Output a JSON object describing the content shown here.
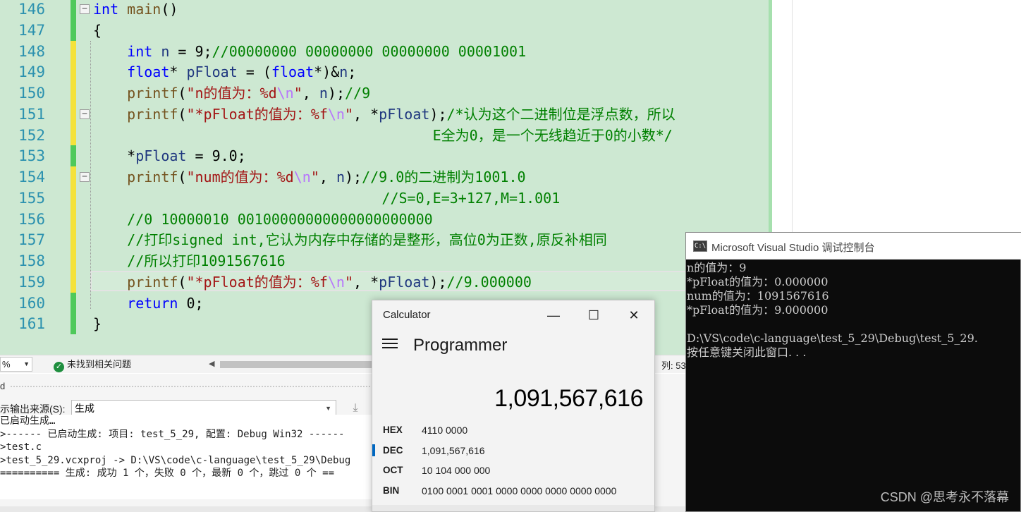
{
  "editor": {
    "lines": [
      {
        "num": "146",
        "bar": "#4fc95b",
        "fold": "−",
        "tokens": [
          [
            "kw",
            "int"
          ],
          [
            "plain",
            " "
          ],
          [
            "fn",
            "main"
          ],
          [
            "plain",
            "()"
          ]
        ]
      },
      {
        "num": "147",
        "bar": "#4fc95b",
        "fold": "",
        "tokens": [
          [
            "plain",
            "{"
          ]
        ]
      },
      {
        "num": "148",
        "bar": "#f4e23c",
        "fold": "",
        "tokens": [
          [
            "plain",
            "    "
          ],
          [
            "kw",
            "int"
          ],
          [
            "plain",
            " "
          ],
          [
            "var",
            "n"
          ],
          [
            "plain",
            " = 9;"
          ],
          [
            "cmt",
            "//00000000 00000000 00000000 00001001"
          ]
        ]
      },
      {
        "num": "149",
        "bar": "#f4e23c",
        "fold": "",
        "tokens": [
          [
            "plain",
            "    "
          ],
          [
            "kw",
            "float"
          ],
          [
            "plain",
            "* "
          ],
          [
            "var",
            "pFloat"
          ],
          [
            "plain",
            " = ("
          ],
          [
            "kw",
            "float"
          ],
          [
            "plain",
            "*)&"
          ],
          [
            "var",
            "n"
          ],
          [
            "plain",
            ";"
          ]
        ]
      },
      {
        "num": "150",
        "bar": "#f4e23c",
        "fold": "",
        "tokens": [
          [
            "plain",
            "    "
          ],
          [
            "fn",
            "printf"
          ],
          [
            "plain",
            "("
          ],
          [
            "str",
            "\"n的值为：%d"
          ],
          [
            "esc",
            "\\n"
          ],
          [
            "str",
            "\""
          ],
          [
            "plain",
            ", "
          ],
          [
            "var",
            "n"
          ],
          [
            "plain",
            ");"
          ],
          [
            "cmt",
            "//9"
          ]
        ]
      },
      {
        "num": "151",
        "bar": "#f4e23c",
        "fold": "−",
        "tokens": [
          [
            "plain",
            "    "
          ],
          [
            "fn",
            "printf"
          ],
          [
            "plain",
            "("
          ],
          [
            "str",
            "\"*pFloat的值为：%f"
          ],
          [
            "esc",
            "\\n"
          ],
          [
            "str",
            "\""
          ],
          [
            "plain",
            ", *"
          ],
          [
            "var",
            "pFloat"
          ],
          [
            "plain",
            ");"
          ],
          [
            "cmt",
            "/*认为这个二进制位是浮点数，所以"
          ]
        ]
      },
      {
        "num": "152",
        "bar": "#f4e23c",
        "fold": "",
        "tokens": [
          [
            "plain",
            "                                        "
          ],
          [
            "cmt",
            "E全为0，是一个无线趋近于0的小数*/"
          ]
        ]
      },
      {
        "num": "153",
        "bar": "#4fc95b",
        "fold": "",
        "tokens": [
          [
            "plain",
            "    *"
          ],
          [
            "var",
            "pFloat"
          ],
          [
            "plain",
            " = 9.0;"
          ]
        ]
      },
      {
        "num": "154",
        "bar": "#f4e23c",
        "fold": "−",
        "tokens": [
          [
            "plain",
            "    "
          ],
          [
            "fn",
            "printf"
          ],
          [
            "plain",
            "("
          ],
          [
            "str",
            "\"num的值为：%d"
          ],
          [
            "esc",
            "\\n"
          ],
          [
            "str",
            "\""
          ],
          [
            "plain",
            ", "
          ],
          [
            "var",
            "n"
          ],
          [
            "plain",
            ");"
          ],
          [
            "cmt",
            "//9.0的二进制为1001.0"
          ]
        ]
      },
      {
        "num": "155",
        "bar": "#f4e23c",
        "fold": "",
        "tokens": [
          [
            "plain",
            "                                  "
          ],
          [
            "cmt",
            "//S=0,E=3+127,M=1.001"
          ]
        ]
      },
      {
        "num": "156",
        "bar": "#f4e23c",
        "fold": "",
        "tokens": [
          [
            "plain",
            "    "
          ],
          [
            "cmt",
            "//0 10000010 00100000000000000000000"
          ]
        ]
      },
      {
        "num": "157",
        "bar": "#f4e23c",
        "fold": "",
        "tokens": [
          [
            "plain",
            "    "
          ],
          [
            "cmt",
            "//打印signed int,它认为内存中存储的是整形，高位0为正数,原反补相同"
          ]
        ]
      },
      {
        "num": "158",
        "bar": "#f4e23c",
        "fold": "",
        "tokens": [
          [
            "plain",
            "    "
          ],
          [
            "cmt",
            "//所以打印1091567616"
          ]
        ]
      },
      {
        "num": "159",
        "bar": "#f4e23c",
        "fold": "",
        "tokens": [
          [
            "plain",
            "    "
          ],
          [
            "fn",
            "printf"
          ],
          [
            "plain",
            "("
          ],
          [
            "str",
            "\"*pFloat的值为：%f"
          ],
          [
            "esc",
            "\\n"
          ],
          [
            "str",
            "\""
          ],
          [
            "plain",
            ", *"
          ],
          [
            "var",
            "pFloat"
          ],
          [
            "plain",
            ");"
          ],
          [
            "cmt",
            "//9.000000"
          ]
        ]
      },
      {
        "num": "160",
        "bar": "#4fc95b",
        "fold": "",
        "tokens": [
          [
            "plain",
            "    "
          ],
          [
            "kw",
            "return"
          ],
          [
            "plain",
            " 0;"
          ]
        ]
      },
      {
        "num": "161",
        "bar": "#4fc95b",
        "fold": "",
        "tokens": [
          [
            "plain",
            "}"
          ]
        ]
      }
    ]
  },
  "statusbar": {
    "zoom": "%",
    "issues": "未找到相关问题",
    "position": "列: 53"
  },
  "output": {
    "source_label": "示输出来源(S):",
    "source_value": "生成",
    "lines": [
      "已启动生成…",
      ">------ 已启动生成: 项目: test_5_29, 配置: Debug Win32 ------",
      ">test.c",
      ">test_5_29.vcxproj -> D:\\VS\\code\\c-language\\test_5_29\\Debug",
      "========== 生成: 成功 1 个，失败 0 个，最新 0 个，跳过 0 个 =="
    ]
  },
  "calculator": {
    "title": "Calculator",
    "mode": "Programmer",
    "display": "1,091,567,616",
    "radix": [
      {
        "label": "HEX",
        "value": "4110 0000",
        "selected": false
      },
      {
        "label": "DEC",
        "value": "1,091,567,616",
        "selected": true
      },
      {
        "label": "OCT",
        "value": "10 104 000 000",
        "selected": false
      },
      {
        "label": "BIN",
        "value": "0100 0001 0001 0000 0000 0000 0000 0000",
        "selected": false
      }
    ]
  },
  "console": {
    "title": "Microsoft Visual Studio 调试控制台",
    "icon": "console-app-icon",
    "lines": [
      "n的值为：9",
      "*pFloat的值为：0.000000",
      "num的值为：1091567616",
      "*pFloat的值为：9.000000",
      "",
      "D:\\VS\\code\\c-language\\test_5_29\\Debug\\test_5_29.",
      "按任意键关闭此窗口. . ."
    ],
    "watermark": "CSDN @思考永不落幕"
  }
}
